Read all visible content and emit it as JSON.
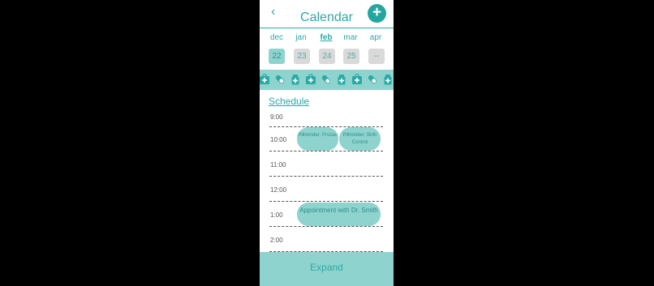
{
  "header": {
    "title": "Calendar",
    "back_icon": "chevron-left-icon",
    "add_icon": "plus-icon",
    "back_glyph": "‹",
    "add_glyph": "+"
  },
  "months": [
    "dec",
    "jan",
    "feb",
    "mar",
    "apr"
  ],
  "selected_month": "feb",
  "days": [
    "22",
    "23",
    "24",
    "25",
    "--"
  ],
  "selected_day": "22",
  "icon_strip": {
    "pattern": [
      "first-aid-kit-icon",
      "pill-icon",
      "medicine-bottle-icon"
    ],
    "color": "#2aaaa5"
  },
  "schedule": {
    "link_label": "Schedule",
    "times": [
      "9:00",
      "10:00",
      "11:00",
      "12:00",
      "1:00",
      "2:00"
    ],
    "events": [
      {
        "label": "Pillminder: Prozac",
        "time": "10:00"
      },
      {
        "label": "Pillminder: Birth Control",
        "time": "10:00"
      },
      {
        "label": "Appointment with Dr. Smith",
        "time": "1:00"
      }
    ]
  },
  "expand_label": "Expand",
  "colors": {
    "accent": "#2aaaa5",
    "accent_light": "#8fd3cf",
    "day_bg": "#d9d9d9",
    "background": "#000000"
  }
}
